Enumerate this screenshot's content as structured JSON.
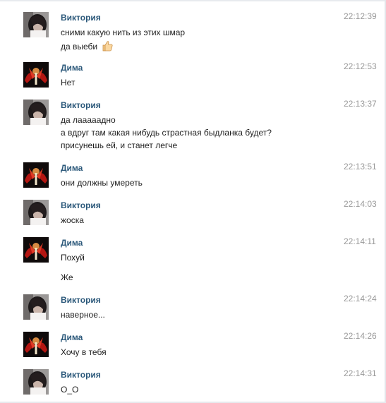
{
  "colors": {
    "author": "#2b587a",
    "time": "#999999",
    "text": "#1f1f1f"
  },
  "messages": [
    {
      "author": "Виктория",
      "avatar": "girl-avatar",
      "time": "22:12:39",
      "lines": [
        "сними какую нить из этих шмар",
        "да выеби"
      ],
      "emoji": "thumbs-up-icon"
    },
    {
      "author": "Дима",
      "avatar": "dragon-avatar",
      "time": "22:12:53",
      "lines": [
        "Нет"
      ]
    },
    {
      "author": "Виктория",
      "avatar": "girl-avatar",
      "time": "22:13:37",
      "lines": [
        "да лааааадно",
        "а вдруг там какая нибудь страстная быдланка будет?",
        "присунешь ей, и станет легче"
      ]
    },
    {
      "author": "Дима",
      "avatar": "dragon-avatar",
      "time": "22:13:51",
      "lines": [
        "они должны умереть"
      ]
    },
    {
      "author": "Виктория",
      "avatar": "girl-avatar",
      "time": "22:14:03",
      "lines": [
        "жоска"
      ]
    },
    {
      "author": "Дима",
      "avatar": "dragon-avatar",
      "time": "22:14:11",
      "lines": [
        "Похуй",
        "Же"
      ]
    },
    {
      "author": "Виктория",
      "avatar": "girl-avatar",
      "time": "22:14:24",
      "lines": [
        "наверное..."
      ]
    },
    {
      "author": "Дима",
      "avatar": "dragon-avatar",
      "time": "22:14:26",
      "lines": [
        "Хочу в тебя"
      ]
    },
    {
      "author": "Виктория",
      "avatar": "girl-avatar",
      "time": "22:14:31",
      "lines": [
        "О_О"
      ]
    }
  ]
}
